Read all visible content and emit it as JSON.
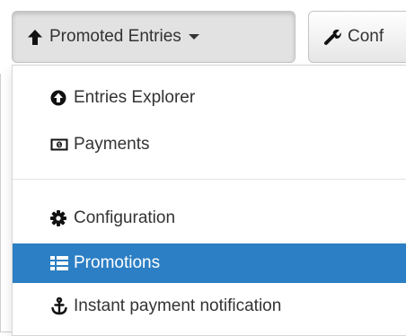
{
  "toolbar": {
    "promoted_label": "Promoted Entries",
    "promoted_icon": "arrow-up-icon",
    "config_label": "Conf",
    "config_icon": "wrench-icon"
  },
  "menu": {
    "items": [
      {
        "label": "Entries Explorer",
        "icon": "circle-arrow-up-icon",
        "active": false
      },
      {
        "label": "Payments",
        "icon": "money-icon",
        "active": false
      },
      {
        "label": "Configuration",
        "icon": "cog-icon",
        "active": false
      },
      {
        "label": "Promotions",
        "icon": "list-icon",
        "active": true
      },
      {
        "label": "Instant payment notification",
        "icon": "anchor-icon",
        "active": false
      }
    ]
  },
  "colors": {
    "active_bg": "#2c7fc4",
    "active_text": "#ffffff",
    "text": "#333333"
  }
}
